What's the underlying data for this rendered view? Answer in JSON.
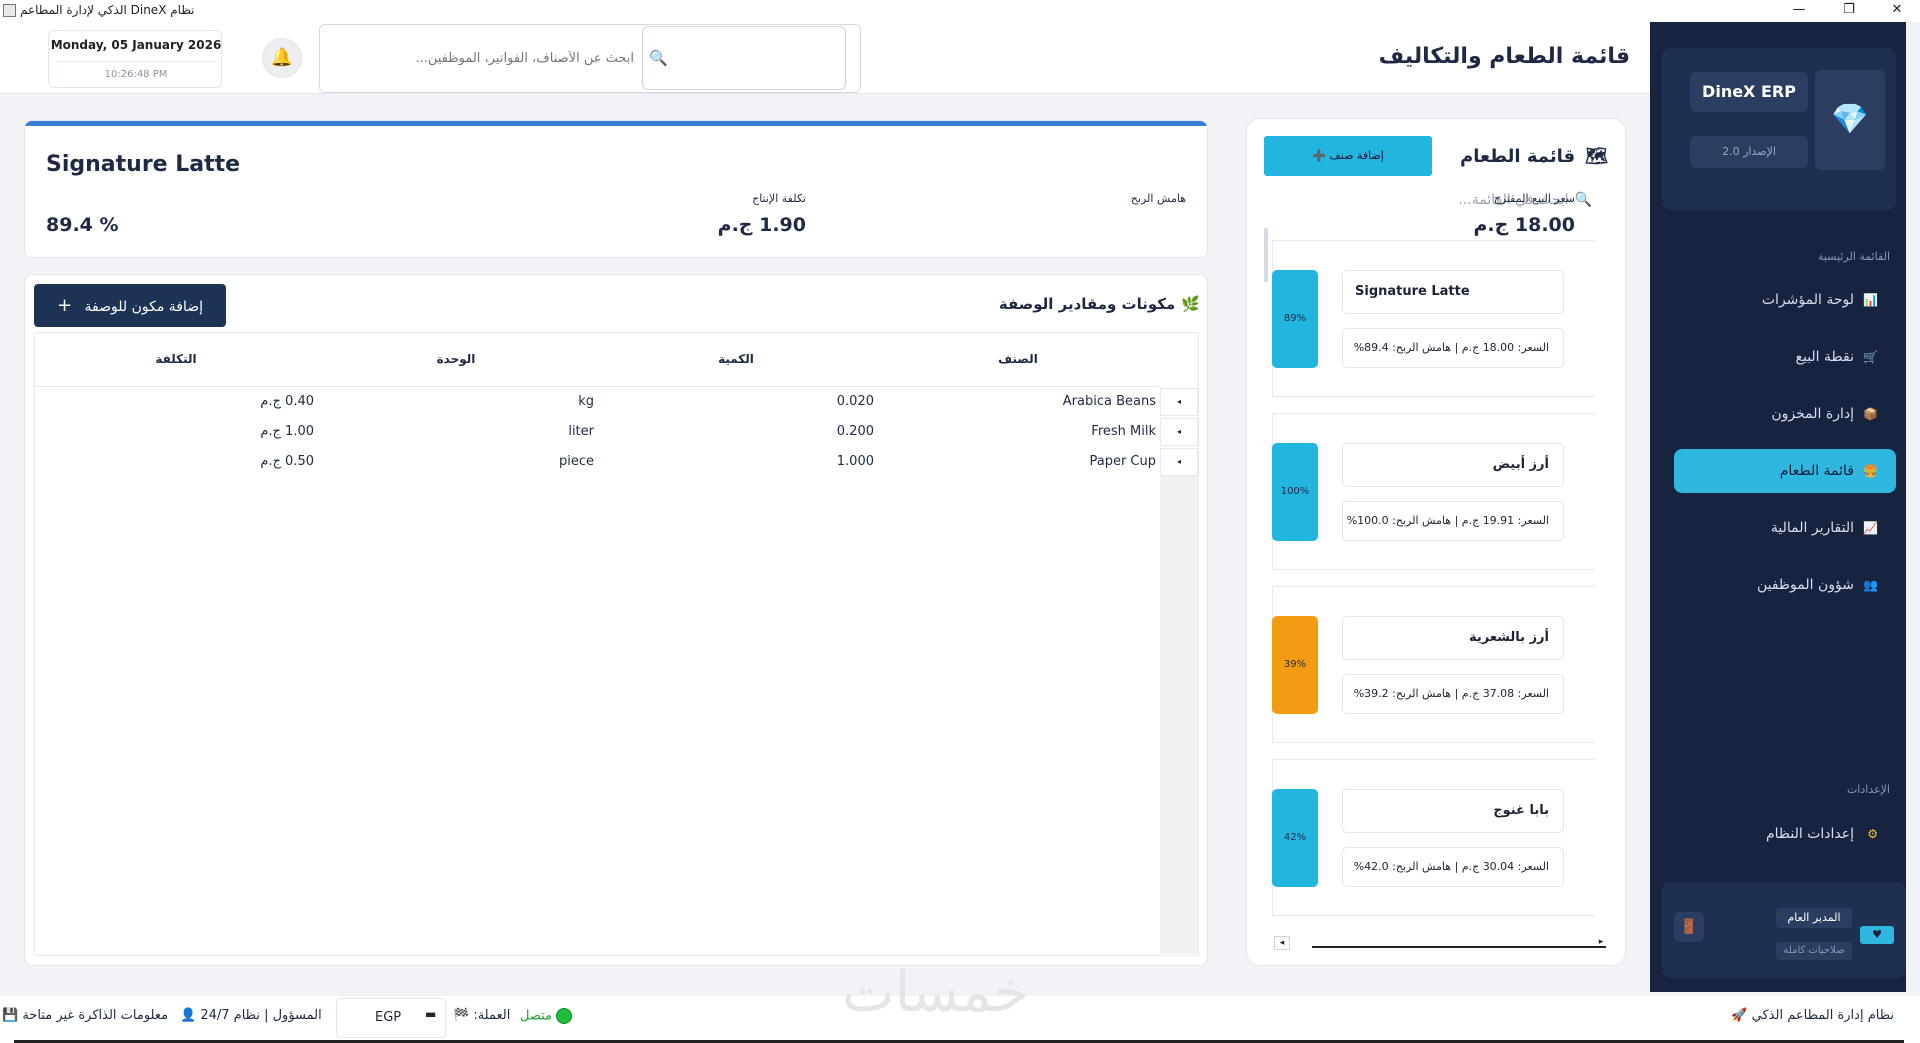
{
  "window": {
    "title": "نظام DineX الذكي لإدارة المطاعم",
    "controls": {
      "minimize": "—",
      "maximize": "❐",
      "close": "✕"
    }
  },
  "header": {
    "page_title": "قائمة الطعام والتكاليف",
    "date": "Monday, 05 January 2026",
    "time": "10:26:48 PM",
    "search_placeholder": "ابحث عن الأصناف، الفواتير، الموظفين...",
    "icons": {
      "bell": "bell-icon",
      "search": "search-icon"
    }
  },
  "sidebar": {
    "brand_name": "DineX ERP",
    "version": "الإصدار 2.0",
    "main_section_label": "القائمة الرئيسية",
    "items": [
      {
        "label": "لوحة المؤشرات",
        "icon": "chart-icon",
        "active": false
      },
      {
        "label": "نقطة البيع",
        "icon": "cart-icon",
        "active": false
      },
      {
        "label": "إدارة المخزون",
        "icon": "box-icon",
        "active": false
      },
      {
        "label": "قائمة الطعام",
        "icon": "menu-book-icon",
        "active": true
      },
      {
        "label": "التقارير المالية",
        "icon": "trend-icon",
        "active": false
      },
      {
        "label": "شؤون الموظفين",
        "icon": "people-icon",
        "active": false
      }
    ],
    "settings_section_label": "الإعدادات",
    "settings_item": {
      "label": "إعدادات النظام",
      "icon": "gear-icon"
    },
    "user": {
      "name": "المدير العام",
      "role": "صلاحيات كاملة"
    }
  },
  "menu_panel": {
    "title": "قائمة الطعام",
    "add_button": "إضافة صنف",
    "search_placeholder": "ابحث في القائمة...",
    "items": [
      {
        "name": "Signature Latte",
        "details": "السعر: 18.00 ج.م | هامش الربح: 89.4%",
        "margin_label": "89%",
        "margin": 89,
        "color": "#21b5df"
      },
      {
        "name": "أرز أبيض",
        "details": "السعر: 19.91 ج.م | هامش الربح: 100.0%",
        "margin_label": "100%",
        "margin": 100,
        "color": "#21b5df"
      },
      {
        "name": "أرز بالشعرية",
        "details": "السعر: 37.08 ج.م | هامش الربح: 39.2%",
        "margin_label": "39%",
        "margin": 39,
        "color": "#f39c12"
      },
      {
        "name": "بابا غنوج",
        "details": "السعر: 30.04 ج.م | هامش الربح: 42.0%",
        "margin_label": "42%",
        "margin": 42,
        "color": "#21b5df"
      }
    ]
  },
  "item_detail": {
    "name": "Signature Latte",
    "price_label": "سعر البيع المقترح",
    "price_value": "18.00 ج.م",
    "cost_label": "تكلفة الإنتاج",
    "cost_value": "1.90 ج.م",
    "margin_label": "هامش الربح",
    "margin_value": "89.4 %"
  },
  "recipe": {
    "title": "مكونات ومقادير الوصفة",
    "add_button": "إضافة مكون للوصفة",
    "columns": [
      "الصنف",
      "الكمية",
      "الوحدة",
      "التكلفة"
    ],
    "rows": [
      {
        "item": "Arabica Beans",
        "qty": "0.020",
        "unit": "kg",
        "cost": "0.40 ج.م"
      },
      {
        "item": "Fresh Milk",
        "qty": "0.200",
        "unit": "liter",
        "cost": "1.00 ج.م"
      },
      {
        "item": "Paper Cup",
        "qty": "1.000",
        "unit": "piece",
        "cost": "0.50 ج.م"
      }
    ]
  },
  "status_bar": {
    "app_name": "نظام إدارة المطاعم الذكي",
    "connection": "متصل",
    "currency_label": "العملة:",
    "currency_value": "EGP",
    "user_info": "المسؤول | نظام 24/7",
    "memory": "معلومات الذاكرة غير متاحة"
  },
  "watermark": "خمسات"
}
